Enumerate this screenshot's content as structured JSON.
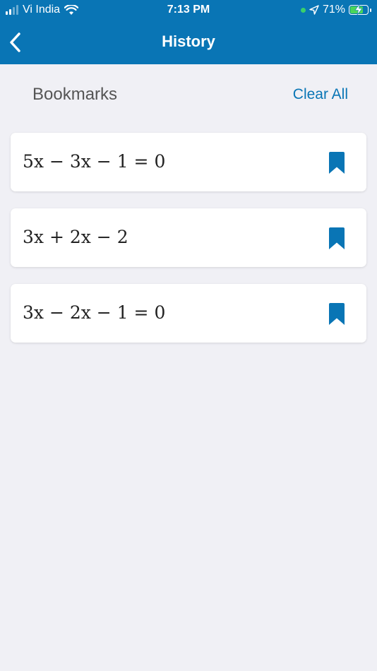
{
  "status_bar": {
    "carrier": "Vi India",
    "time": "7:13 PM",
    "battery": "71%",
    "icons": [
      "signal-icon",
      "wifi-icon",
      "location-arrow-icon",
      "battery-charging-icon"
    ]
  },
  "nav": {
    "title": "History",
    "back_icon": "chevron-left-icon"
  },
  "section": {
    "title": "Bookmarks",
    "clear_all": "Clear All"
  },
  "bookmarks": [
    {
      "expression": "5x − 3x − 1 = 0",
      "icon": "bookmark-icon"
    },
    {
      "expression": "3x + 2x − 2",
      "icon": "bookmark-icon"
    },
    {
      "expression": "3x − 2x − 1 = 0",
      "icon": "bookmark-icon"
    }
  ],
  "colors": {
    "primary": "#0975b5",
    "background": "#f0f0f5",
    "card": "#ffffff",
    "battery_fill": "#49d65a"
  }
}
